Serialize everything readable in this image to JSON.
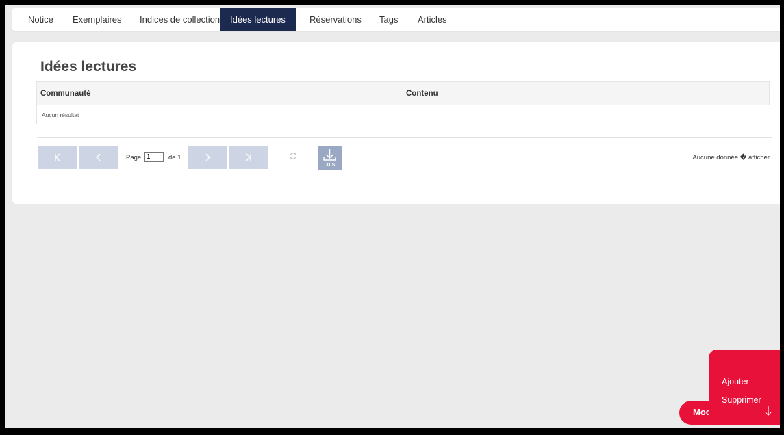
{
  "tabs": [
    {
      "label": "Notice"
    },
    {
      "label": "Exemplaires"
    },
    {
      "label": "Indices de collection"
    },
    {
      "label": "Idées lectures",
      "active": true
    },
    {
      "label": "Réservations"
    },
    {
      "label": "Tags"
    },
    {
      "label": "Articles"
    }
  ],
  "section": {
    "title": "Idées lectures"
  },
  "grid": {
    "columns": [
      "Communauté",
      "Contenu"
    ],
    "empty_text": "Aucun résultat"
  },
  "pager": {
    "first_icon": "first-page-icon",
    "prev_icon": "prev-page-icon",
    "next_icon": "next-page-icon",
    "last_icon": "last-page-icon",
    "page_label": "Page",
    "page_value": "1",
    "of_label": "de 1",
    "refresh_icon": "refresh-icon",
    "export_icon": "download-xls-icon",
    "export_label": ".XLS",
    "status": "Aucune donnée � afficher"
  },
  "actions": {
    "button_label": "Mod",
    "arrow_icon": "arrow-down-icon",
    "menu": [
      "Ajouter",
      "Supprimer"
    ]
  },
  "colors": {
    "active_tab": "#1d2a4f",
    "pager_button": "#cdd4e3",
    "export_button": "#9aa8c4",
    "accent": "#e8113a"
  }
}
